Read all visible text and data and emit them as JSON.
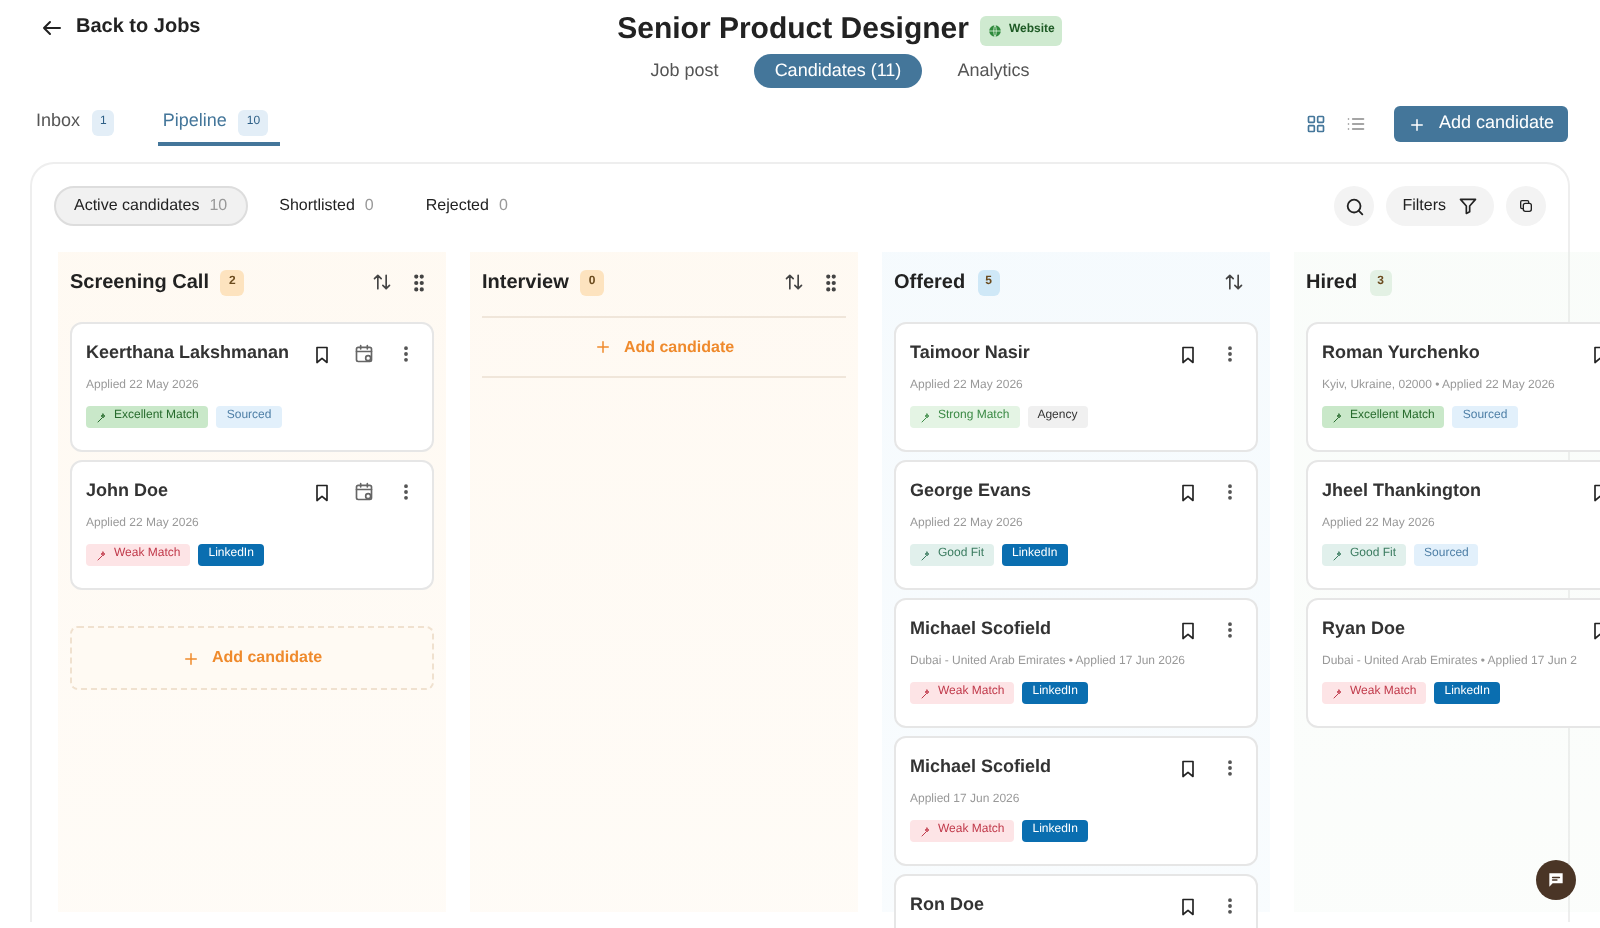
{
  "header": {
    "back_link": "Back to Jobs",
    "title": "Senior Product Designer",
    "source_badge": "Website"
  },
  "main_tabs": [
    {
      "label": "Job post",
      "selected": false
    },
    {
      "label": "Candidates (11)",
      "selected": true
    },
    {
      "label": "Analytics",
      "selected": false
    }
  ],
  "sub_tabs": [
    {
      "label": "Inbox",
      "count": "1",
      "selected": false
    },
    {
      "label": "Pipeline",
      "count": "10",
      "selected": true
    }
  ],
  "view_toggle": [
    {
      "kind": "grid",
      "selected": true
    },
    {
      "kind": "list",
      "selected": false
    }
  ],
  "add_button": "Add candidate",
  "filters": [
    {
      "label": "Active candidates",
      "count": "10",
      "selected": true
    },
    {
      "label": "Shortlisted",
      "count": "0",
      "selected": false
    },
    {
      "label": "Rejected",
      "count": "0",
      "selected": false
    }
  ],
  "filters_button": "Filters",
  "columns": [
    {
      "title": "Screening Call",
      "count": "2",
      "color": "#fde3bf",
      "sortable": true,
      "draggable": true,
      "items": [
        {
          "kind": "candidate",
          "name": "Keerthana Lakshmanan",
          "meta": "Applied 22 May 2026",
          "schedule": true,
          "tags": [
            {
              "kind": "excellent",
              "label": "Excellent Match"
            },
            {
              "kind": "sourced",
              "label": "Sourced"
            }
          ]
        },
        {
          "kind": "candidate",
          "name": "John Doe",
          "meta": "Applied 22 May 2026",
          "schedule": true,
          "tags": [
            {
              "kind": "weak",
              "label": "Weak Match"
            },
            {
              "kind": "linkedin",
              "label": "LinkedIn"
            }
          ]
        },
        {
          "kind": "add_box",
          "label": "Add candidate"
        }
      ]
    },
    {
      "title": "Interview",
      "count": "0",
      "color": "#fde3bf",
      "sortable": true,
      "draggable": true,
      "items": [
        {
          "kind": "add_line",
          "label": "Add candidate"
        }
      ]
    },
    {
      "title": "Offered",
      "count": "5",
      "color": "#cfe8f7",
      "sortable": true,
      "draggable": false,
      "items": [
        {
          "kind": "candidate",
          "name": "Taimoor Nasir",
          "meta": "Applied 22 May 2026",
          "schedule": false,
          "tags": [
            {
              "kind": "strong",
              "label": "Strong Match"
            },
            {
              "kind": "agency",
              "label": "Agency"
            }
          ]
        },
        {
          "kind": "candidate",
          "name": "George Evans",
          "meta": "Applied 22 May 2026",
          "schedule": false,
          "tags": [
            {
              "kind": "good",
              "label": "Good Fit"
            },
            {
              "kind": "linkedin",
              "label": "LinkedIn"
            }
          ]
        },
        {
          "kind": "candidate",
          "name": "Michael Scofield",
          "meta": "Dubai - United Arab Emirates • Applied 17 Jun 2026",
          "schedule": false,
          "tags": [
            {
              "kind": "weak",
              "label": "Weak Match"
            },
            {
              "kind": "linkedin",
              "label": "LinkedIn"
            }
          ]
        },
        {
          "kind": "candidate",
          "name": "Michael Scofield",
          "meta": "Applied 17 Jun 2026",
          "schedule": false,
          "tags": [
            {
              "kind": "weak",
              "label": "Weak Match"
            },
            {
              "kind": "linkedin",
              "label": "LinkedIn"
            }
          ]
        },
        {
          "kind": "candidate",
          "name": "Ron Doe",
          "schedule": false
        }
      ]
    },
    {
      "title": "Hired",
      "count": "3",
      "color": "#e3f1e4",
      "sortable": false,
      "draggable": false,
      "items": [
        {
          "kind": "candidate",
          "name": "Roman Yurchenko",
          "meta": "Kyiv, Ukraine, 02000 • Applied 22 May 2026",
          "schedule": false,
          "tags": [
            {
              "kind": "excellent",
              "label": "Excellent Match"
            },
            {
              "kind": "sourced",
              "label": "Sourced"
            }
          ]
        },
        {
          "kind": "candidate",
          "name": "Jheel Thankington",
          "meta": "Applied 22 May 2026",
          "schedule": false,
          "tags": [
            {
              "kind": "good",
              "label": "Good Fit"
            },
            {
              "kind": "sourced",
              "label": "Sourced"
            }
          ]
        },
        {
          "kind": "candidate",
          "name": "Ryan Doe",
          "meta": "Dubai - United Arab Emirates • Applied 17 Jun 2",
          "schedule": false,
          "tags": [
            {
              "kind": "weak",
              "label": "Weak Match"
            },
            {
              "kind": "linkedin",
              "label": "LinkedIn"
            }
          ]
        }
      ]
    }
  ]
}
